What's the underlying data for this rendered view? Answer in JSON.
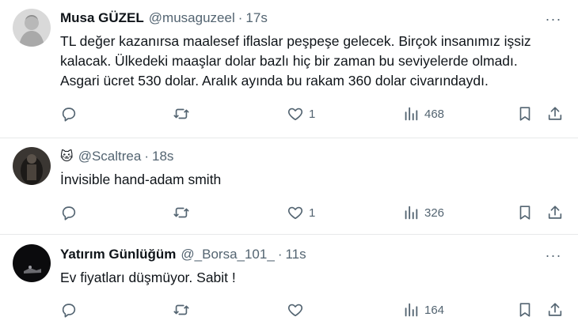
{
  "tweets": [
    {
      "display_name": "Musa GÜZEL",
      "handle": "@musaguzeel",
      "time": "17s",
      "text": "TL değer kazanırsa maalesef iflaslar peşpeşe gelecek. Birçok insanımız işsiz\nkalacak. Ülkedeki maaşlar dolar bazlı hiç bir zaman bu seviyelerde olmadı.\nAsgari ücret 530 dolar. Aralık ayında bu rakam 360 dolar civarındaydı.",
      "likes": "1",
      "views": "468"
    },
    {
      "emoji": "🐱",
      "handle": "@Scaltrea",
      "time": "18s",
      "text": "İnvisible hand-adam smith",
      "likes": "1",
      "views": "326"
    },
    {
      "display_name": "Yatırım Günlüğüm",
      "handle": "@_Borsa_101_",
      "time": "11s",
      "text": "Ev fiyatları düşmüyor. Sabit !",
      "views": "164"
    }
  ],
  "separator": "·",
  "more_glyph": "···",
  "icons": [
    "reply-icon",
    "retweet-icon",
    "like-icon",
    "views-icon",
    "bookmark-icon",
    "share-icon",
    "more-icon"
  ]
}
